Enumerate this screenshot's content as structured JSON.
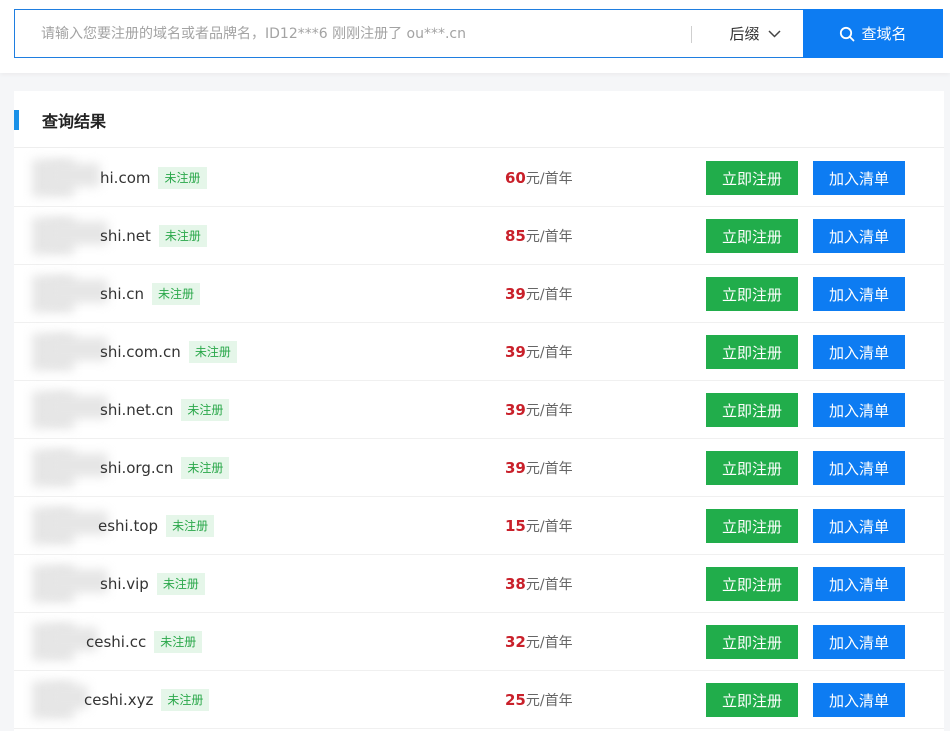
{
  "search": {
    "placeholder": "请输入您要注册的域名或者品牌名，ID12***6 刚刚注册了 ou***.cn",
    "suffix_label": "后缀",
    "button_label": "查域名"
  },
  "results": {
    "title": "查询结果",
    "register_label": "立即注册",
    "add_label": "加入清单",
    "unit": "元/首年",
    "items": [
      {
        "name": "hi.com",
        "status": "未注册",
        "price": "60"
      },
      {
        "name": "shi.net",
        "status": "未注册",
        "price": "85"
      },
      {
        "name": "shi.cn",
        "status": "未注册",
        "price": "39"
      },
      {
        "name": "shi.com.cn",
        "status": "未注册",
        "price": "39"
      },
      {
        "name": "shi.net.cn",
        "status": "未注册",
        "price": "39"
      },
      {
        "name": "shi.org.cn",
        "status": "未注册",
        "price": "39"
      },
      {
        "name": "eshi.top",
        "status": "未注册",
        "price": "15"
      },
      {
        "name": "shi.vip",
        "status": "未注册",
        "price": "38"
      },
      {
        "name": "ceshi.cc",
        "status": "未注册",
        "price": "32"
      },
      {
        "name": "ceshi.xyz",
        "status": "未注册",
        "price": "25"
      }
    ]
  },
  "colors": {
    "accent": "#0d7cf2",
    "register": "#21ad4b",
    "price": "#c9202a",
    "tag_text": "#2aa84a",
    "tag_bg": "#e5f6e9"
  }
}
